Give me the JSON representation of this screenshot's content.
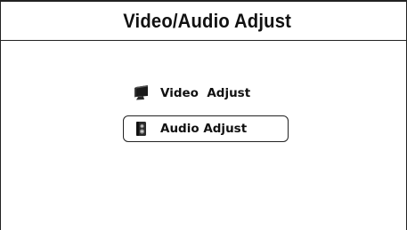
{
  "header": {
    "title": "Video/Audio Adjust"
  },
  "menu": {
    "items": [
      {
        "label": "Video  Adjust",
        "icon": "monitor-icon",
        "selected": false
      },
      {
        "label": "Audio Adjust",
        "icon": "speaker-icon",
        "selected": true
      }
    ]
  },
  "colors": {
    "background": "#ffffff",
    "border": "#222222",
    "text": "#111111"
  }
}
